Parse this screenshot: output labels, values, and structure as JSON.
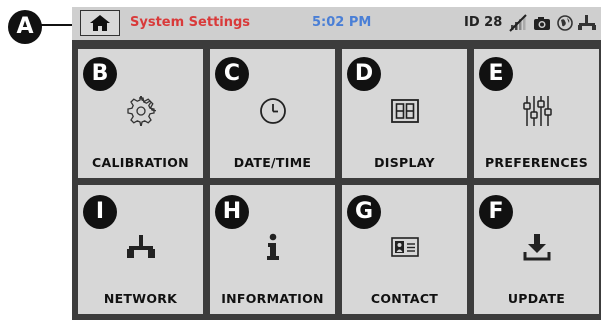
{
  "callouts": [
    "A",
    "B",
    "C",
    "D",
    "E",
    "I",
    "H",
    "G",
    "F"
  ],
  "status_bar": {
    "title": "System Settings",
    "time": "5:02 PM",
    "device_id": "ID 28",
    "colors": {
      "title": "#d93a3a",
      "time": "#4a7fd6"
    }
  },
  "tiles": [
    {
      "label": "CALIBRATION",
      "icon": "gear-icon",
      "callout": "B"
    },
    {
      "label": "DATE/TIME",
      "icon": "clock-icon",
      "callout": "C"
    },
    {
      "label": "DISPLAY",
      "icon": "display-icon",
      "callout": "D"
    },
    {
      "label": "PREFERENCES",
      "icon": "sliders-icon",
      "callout": "E"
    },
    {
      "label": "NETWORK",
      "icon": "network-icon",
      "callout": "I"
    },
    {
      "label": "INFORMATION",
      "icon": "info-icon",
      "callout": "H"
    },
    {
      "label": "CONTACT",
      "icon": "contact-card-icon",
      "callout": "G"
    },
    {
      "label": "UPDATE",
      "icon": "download-icon",
      "callout": "F"
    }
  ]
}
